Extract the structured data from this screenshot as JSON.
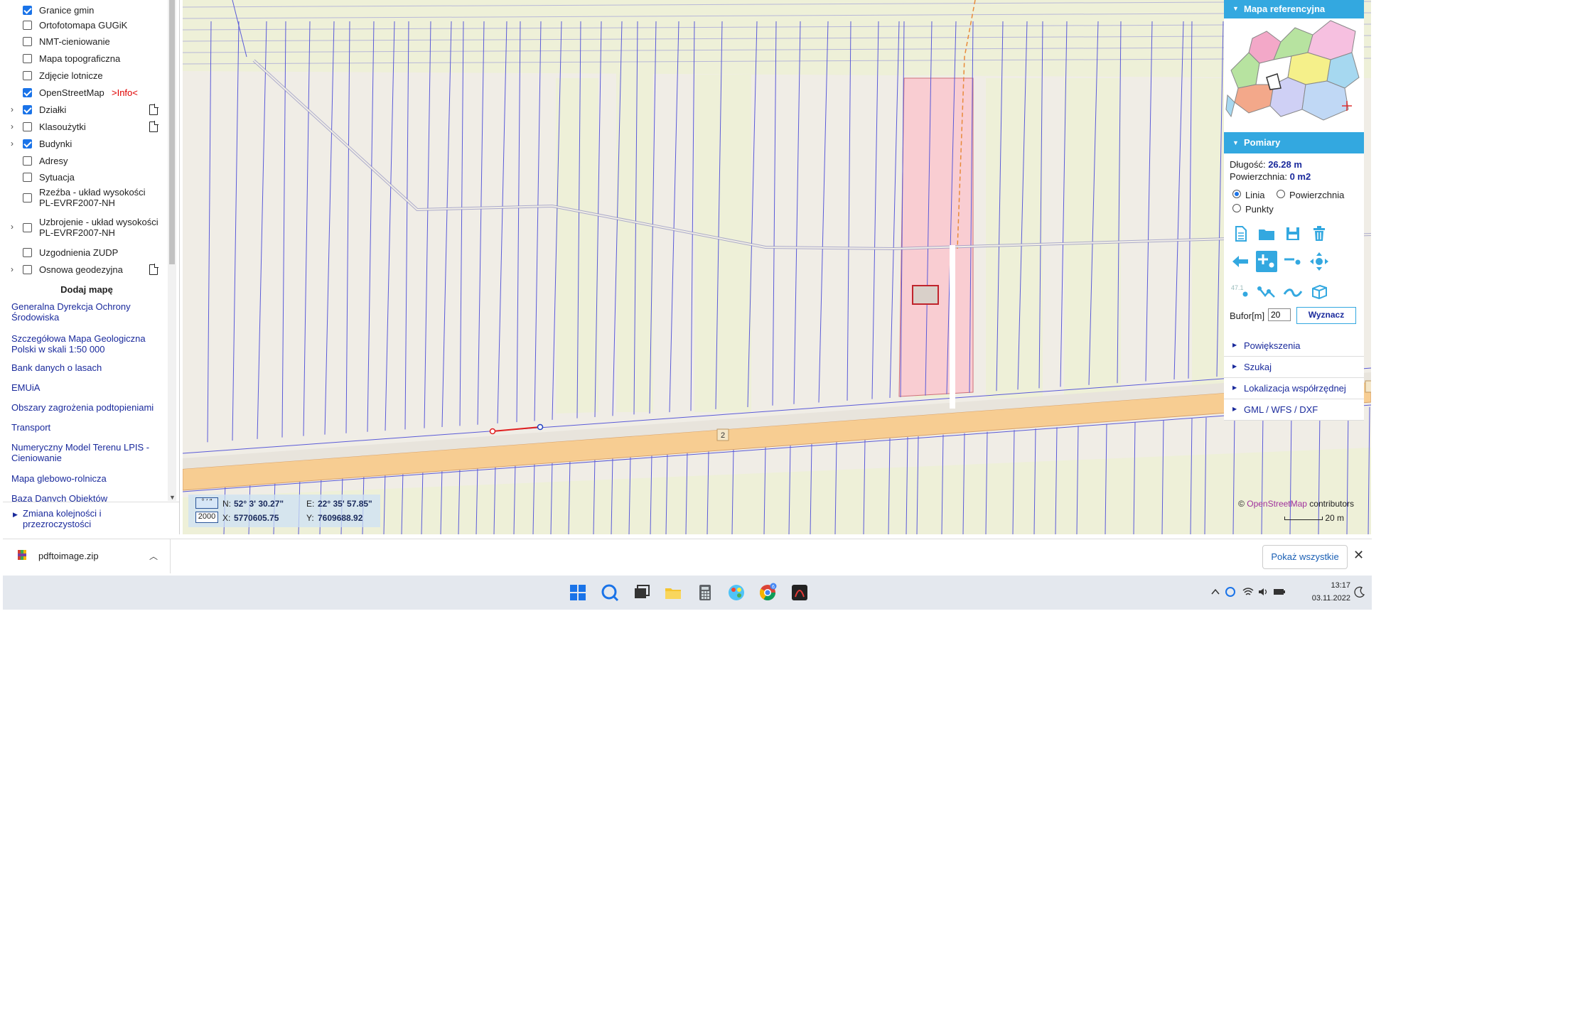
{
  "layers": [
    {
      "label": "Granice gmin",
      "checked": true,
      "expand": false,
      "doc": false
    },
    {
      "label": "Ortofotomapa GUGiK",
      "checked": false,
      "expand": false,
      "doc": false
    },
    {
      "label": "NMT-cieniowanie",
      "checked": false,
      "expand": false,
      "doc": false
    },
    {
      "label": "Mapa topograficzna",
      "checked": false,
      "expand": false,
      "doc": false
    },
    {
      "label": "Zdjęcie lotnicze",
      "checked": false,
      "expand": false,
      "doc": false
    },
    {
      "label": "OpenStreetMap",
      "checked": true,
      "expand": false,
      "doc": false,
      "info": ">Info<"
    },
    {
      "label": "Działki",
      "checked": true,
      "expand": true,
      "doc": true
    },
    {
      "label": "Klasoużytki",
      "checked": false,
      "expand": true,
      "doc": true
    },
    {
      "label": "Budynki",
      "checked": true,
      "expand": true,
      "doc": false
    },
    {
      "label": "Adresy",
      "checked": false,
      "expand": false,
      "doc": false
    },
    {
      "label": "Sytuacja",
      "checked": false,
      "expand": false,
      "doc": false
    },
    {
      "label": "Rzeźba - układ wysokości\nPL-EVRF2007-NH",
      "checked": false,
      "expand": false,
      "doc": false
    },
    {
      "label": "Uzbrojenie - układ wysokości\nPL-EVRF2007-NH",
      "checked": false,
      "expand": true,
      "doc": false
    },
    {
      "label": "Uzgodnienia ZUDP",
      "checked": false,
      "expand": false,
      "doc": false
    },
    {
      "label": "Osnowa geodezyjna",
      "checked": false,
      "expand": true,
      "doc": true
    }
  ],
  "add_map": {
    "title": "Dodaj mapę",
    "links": [
      "Generalna Dyrekcja Ochrony\nŚrodowiska",
      "Szczegółowa Mapa Geologiczna\nPolski w skali 1:50 000",
      "Bank danych o lasach",
      "EMUiA",
      "Obszary zagrożenia podtopieniami",
      "Transport",
      "Numeryczny Model Terenu LPIS -\nCieniowanie",
      "Mapa glebowo-rolnicza",
      "Baza Danych Obiektów"
    ]
  },
  "layer_order": {
    "label": "Zmiana kolejności i\nprzezroczystości"
  },
  "coords": {
    "geo_icon": "° ′ ″",
    "sys_icon": "2000",
    "n_label": "N:",
    "n_value": "52° 3' 30.27\"",
    "e_label": "E:",
    "e_value": "22° 35' 57.85\"",
    "x_label": "X:",
    "x_value": "5770605.75",
    "y_label": "Y:",
    "y_value": "7609688.92"
  },
  "attribution": {
    "prefix": "© ",
    "osm": "OpenStreetMap",
    "suffix": " contributors"
  },
  "scale": {
    "label": "20 m"
  },
  "road_label": "2",
  "right_panel": {
    "minimap_title": "Mapa referencyjna",
    "measure_title": "Pomiary",
    "length_label": "Długość:",
    "length_value": "26.28 m",
    "area_label": "Powierzchnia:",
    "area_value": "0 m2",
    "radio_line": "Linia",
    "radio_area": "Powierzchnia",
    "radio_points": "Punkty",
    "tool_text": "47.1",
    "buffer_label": "Bufor[m]",
    "buffer_value": "20",
    "compute_button": "Wyznacz",
    "sections": [
      "Powiększenia",
      "Szukaj",
      "Lokalizacja współrzędnej",
      "GML / WFS / DXF"
    ]
  },
  "download": {
    "file": "pdftoimage.zip",
    "show_all": "Pokaż wszystkie"
  },
  "taskbar": {
    "time": "13:17",
    "date": "03.11.2022",
    "chrome_badge": "6"
  },
  "colors": {
    "accent": "#33a8e0",
    "link": "#1a2a9c",
    "road": "#f7cd92",
    "parcel_highlight": "#f9cdd2",
    "field": "#eef0d8",
    "parcel_line": "#5a5ad8"
  }
}
